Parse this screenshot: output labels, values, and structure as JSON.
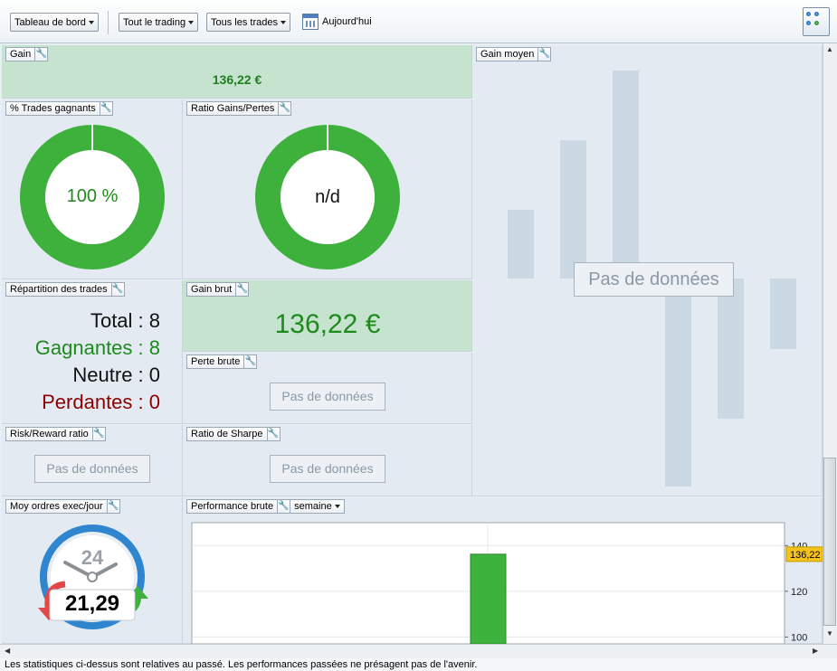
{
  "toolbar": {
    "dashboard": "Tableau de bord",
    "trading": "Tout le trading",
    "trades": "Tous les trades",
    "today": "Aujourd'hui"
  },
  "gain": {
    "title": "Gain",
    "value": "136,22 €"
  },
  "gain_moyen": {
    "title": "Gain moyen",
    "nodata": "Pas de données"
  },
  "pct_gagnants": {
    "title": "% Trades gagnants",
    "value": "100 %",
    "fraction": 1.0
  },
  "ratio_gp": {
    "title": "Ratio Gains/Pertes",
    "value": "n/d",
    "fraction": 1.0
  },
  "repartition": {
    "title": "Répartition des trades",
    "rows": [
      {
        "label": "Total : 8",
        "color": "#111111"
      },
      {
        "label": "Gagnantes : 8",
        "color": "#1e8a1e"
      },
      {
        "label": "Neutre : 0",
        "color": "#111111"
      },
      {
        "label": "Perdantes : 0",
        "color": "#8b0000"
      }
    ]
  },
  "gain_brut": {
    "title": "Gain brut",
    "value": "136,22 €"
  },
  "perte_brute": {
    "title": "Perte brute",
    "nodata": "Pas de données"
  },
  "risk_reward": {
    "title": "Risk/Reward ratio",
    "nodata": "Pas de données"
  },
  "sharpe": {
    "title": "Ratio de Sharpe",
    "nodata": "Pas de données"
  },
  "moy_ordres": {
    "title": "Moy ordres exec/jour",
    "dial": "24",
    "value": "21,29"
  },
  "performance": {
    "title": "Performance brute",
    "period": "semaine",
    "marker": "136,22"
  },
  "chart_data": {
    "type": "bar",
    "values": [
      136.22
    ],
    "yticks": [
      100,
      120,
      140
    ],
    "ylim": [
      97,
      150
    ],
    "bar_color": "#3db23d"
  },
  "footer": "Les statistiques ci-dessus sont relatives au passé. Les performances passées ne présagent pas de l'avenir.",
  "colors": {
    "win": "#3db13c",
    "accent": "#2f7ac0",
    "panel": "#e3eaf1",
    "green_panel": "#c6e3cf"
  }
}
